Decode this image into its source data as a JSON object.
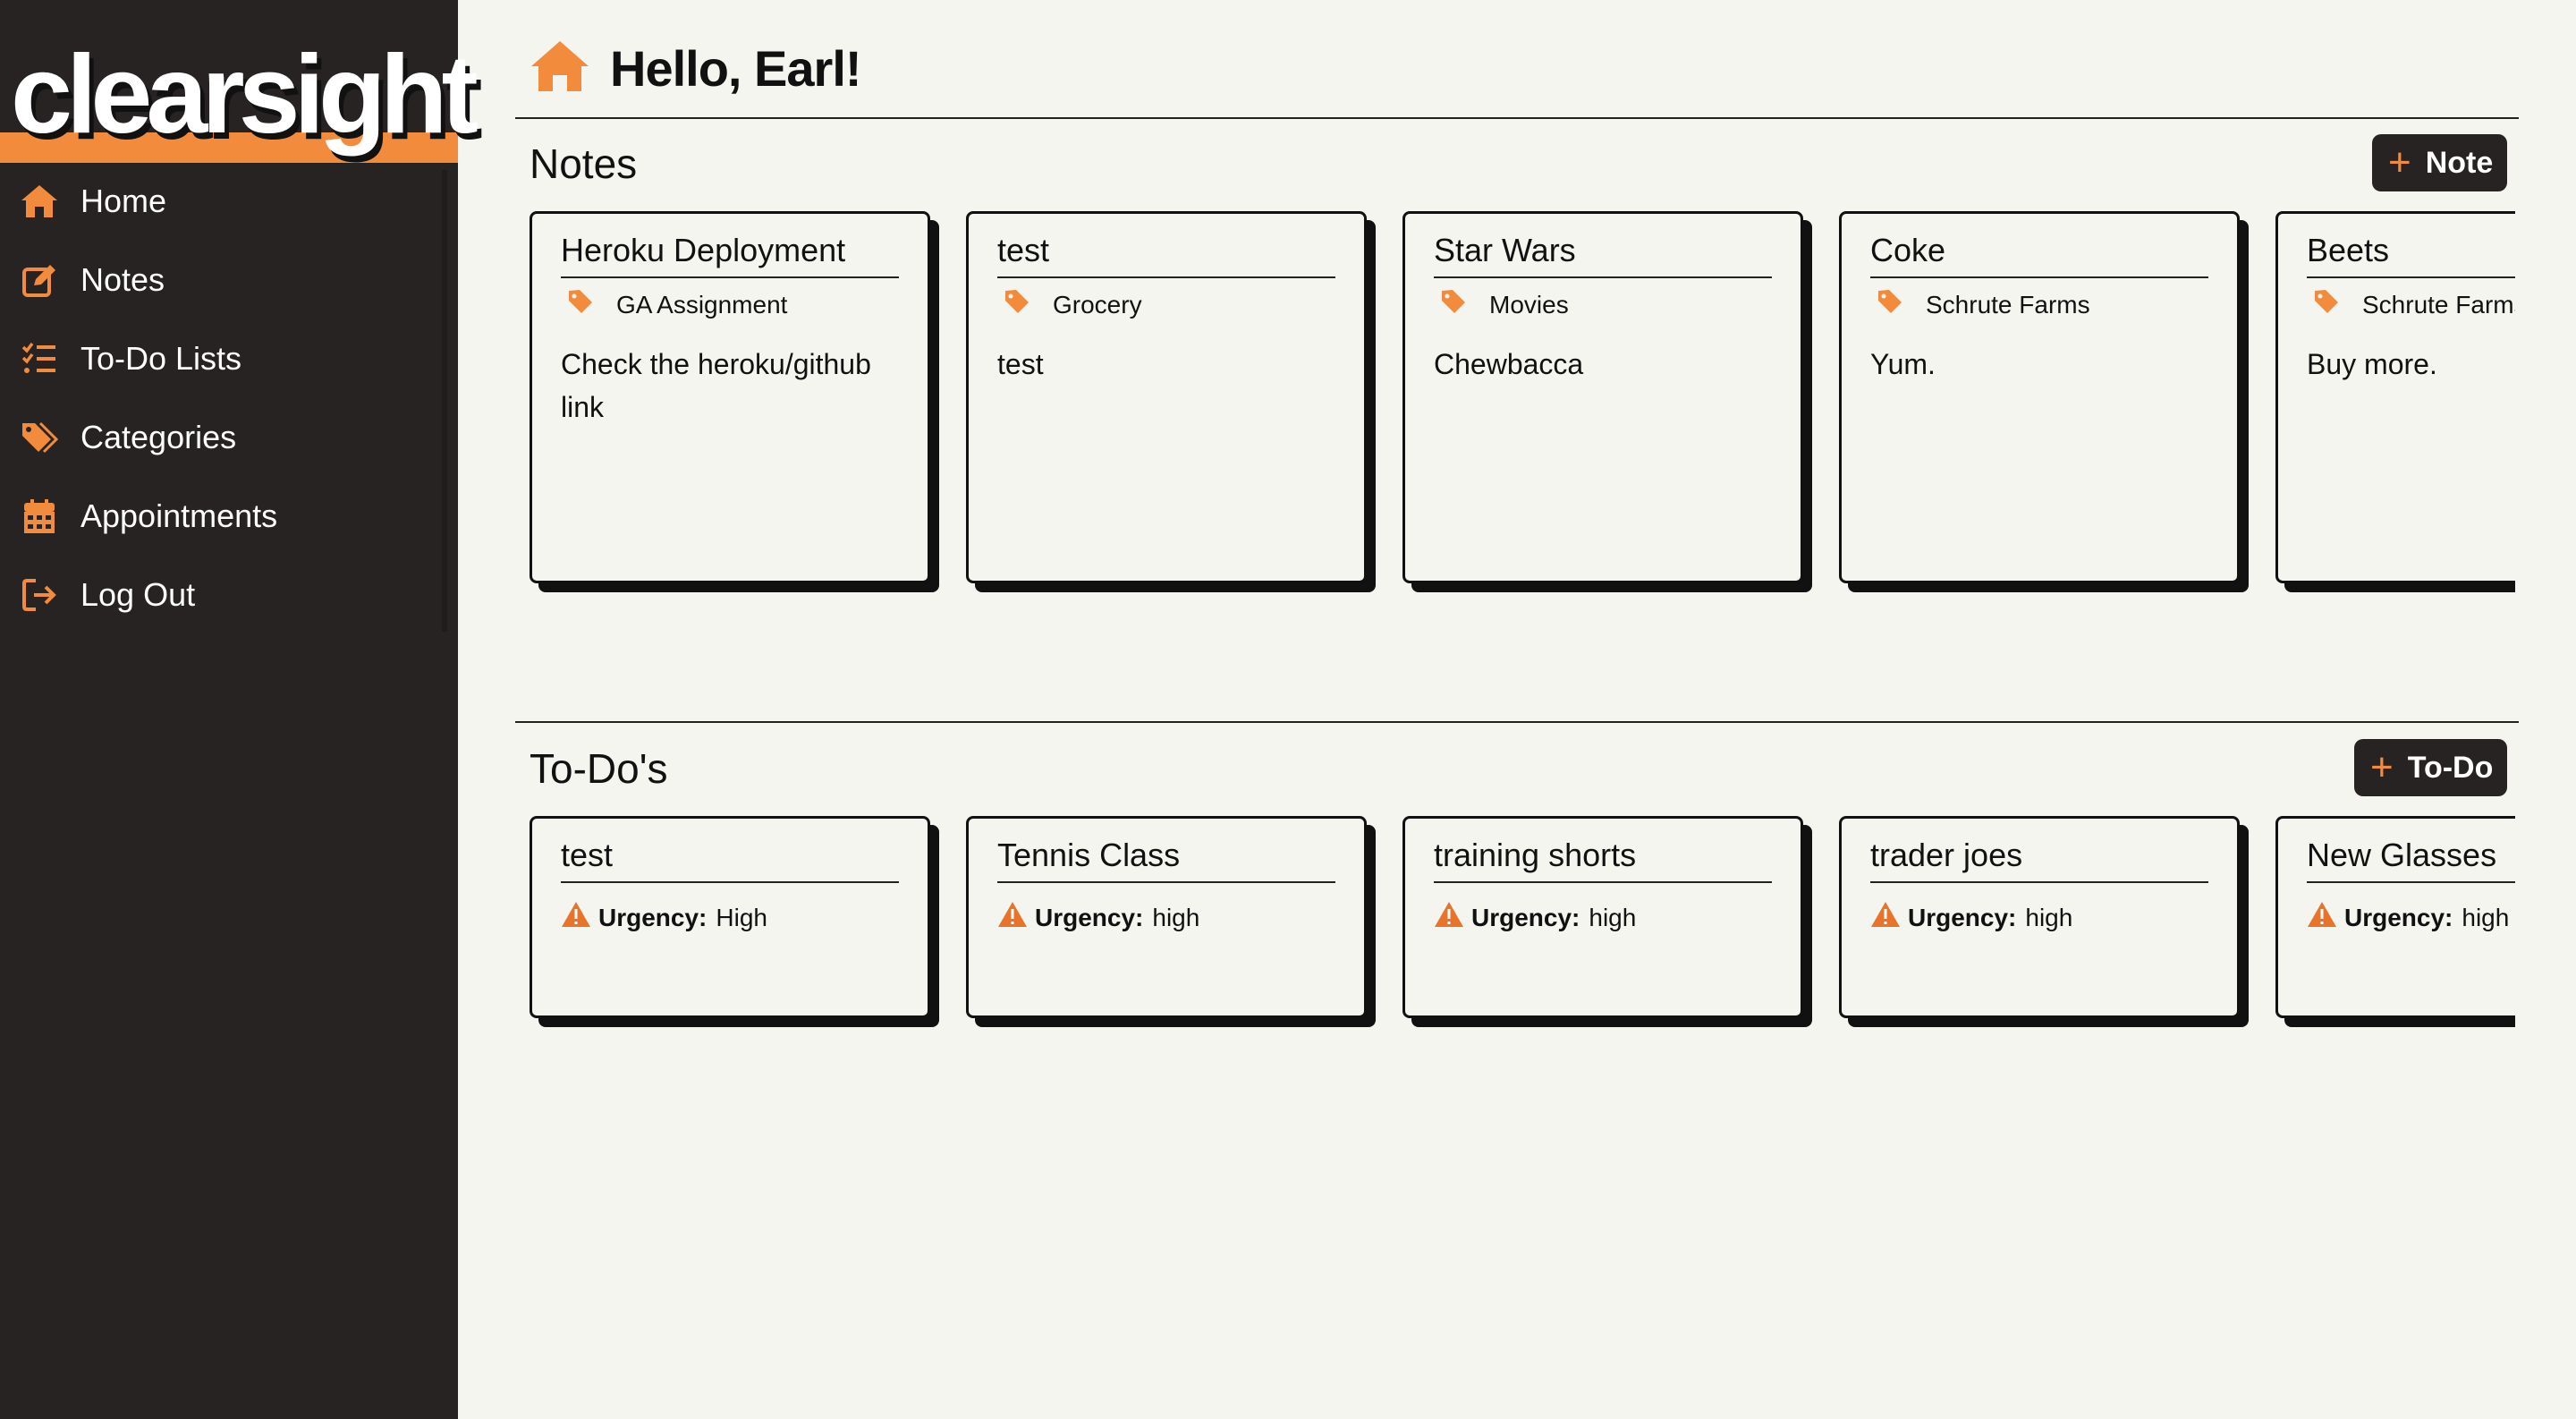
{
  "app": {
    "logo": "clearsight",
    "accent": "#f28c3c",
    "sidebar_bg": "#272322"
  },
  "nav": [
    {
      "label": "Home",
      "icon": "home-icon"
    },
    {
      "label": "Notes",
      "icon": "edit-icon"
    },
    {
      "label": "To-Do Lists",
      "icon": "list-check-icon"
    },
    {
      "label": "Categories",
      "icon": "tags-icon"
    },
    {
      "label": "Appointments",
      "icon": "calendar-icon"
    },
    {
      "label": "Log Out",
      "icon": "logout-icon"
    }
  ],
  "header": {
    "greeting": "Hello, Earl!",
    "icon": "home-icon"
  },
  "notes": {
    "title": "Notes",
    "add_label": "Note",
    "items": [
      {
        "title": "Heroku Deployment",
        "category": "GA Assignment",
        "body": "Check the heroku/github link"
      },
      {
        "title": "test",
        "category": "Grocery",
        "body": "test"
      },
      {
        "title": "Star Wars",
        "category": "Movies",
        "body": "Chewbacca"
      },
      {
        "title": "Coke",
        "category": "Schrute Farms",
        "body": "Yum."
      },
      {
        "title": "Beets",
        "category": "Schrute Farms",
        "body": "Buy more."
      }
    ]
  },
  "todos": {
    "title": "To-Do's",
    "add_label": "To-Do",
    "urgency_label": "Urgency:",
    "items": [
      {
        "title": "test",
        "urgency": "High"
      },
      {
        "title": "Tennis Class",
        "urgency": "high"
      },
      {
        "title": "training shorts",
        "urgency": "high"
      },
      {
        "title": "trader joes",
        "urgency": "high"
      },
      {
        "title": "New Glasses",
        "urgency": "high"
      }
    ]
  }
}
